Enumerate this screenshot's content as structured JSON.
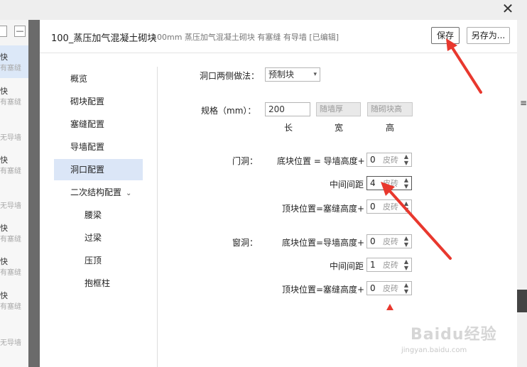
{
  "background_list": {
    "items": [
      {
        "a": "快",
        "b": "有塞缝"
      },
      {
        "a": "快",
        "b": "有塞缝"
      },
      {
        "a": "",
        "b": "无导墙"
      },
      {
        "a": "快",
        "b": "有塞缝"
      },
      {
        "a": "",
        "b": "无导墙"
      },
      {
        "a": "快",
        "b": "有塞缝"
      },
      {
        "a": "快",
        "b": "有塞缝"
      },
      {
        "a": "快",
        "b": "有塞缝"
      },
      {
        "a": "",
        "b": "无导墙"
      }
    ],
    "btn_a": "",
    "btn_b": "—"
  },
  "right_edge_glyph": "≡",
  "close_label": "✕",
  "dialog": {
    "title": "100_蒸压加气混凝土砌块",
    "subtitle": "100mm 蒸压加气混凝土砌块 有塞缝 有导墙 [已编辑]",
    "save_label": "保存",
    "save_as_label": "另存为..."
  },
  "nav": {
    "items": [
      "概览",
      "砌块配置",
      "塞缝配置",
      "导墙配置",
      "洞口配置",
      "二次结构配置"
    ],
    "sub_items": [
      "腰梁",
      "过梁",
      "压顶",
      "抱框柱"
    ],
    "active_index": 4,
    "chevron": "⌄"
  },
  "form": {
    "opening_method_label": "洞口两侧做法：",
    "opening_method_value": "预制块",
    "spec_label": "规格（mm）：",
    "length_value": "200",
    "width_placeholder": "随墙厚",
    "height_placeholder": "随砌块高",
    "length_caption": "长",
    "width_caption": "宽",
    "height_caption": "高",
    "door": {
      "label": "门洞：",
      "bottom_label": "底块位置 = 导墙高度+",
      "bottom_value": "0",
      "middle_label": "中间间距",
      "middle_value": "4",
      "top_label": "顶块位置=塞缝高度+",
      "top_value": "0"
    },
    "window": {
      "label": "窗洞：",
      "bottom_label": "底块位置=导墙高度+",
      "bottom_value": "0",
      "middle_label": "中间间距",
      "middle_value": "1",
      "top_label": "顶块位置=塞缝高度+",
      "top_value": "0"
    },
    "unit": "皮砖"
  },
  "watermark": {
    "main": "Baidu经验",
    "sub": "jingyan.baidu.com"
  },
  "accent_color": "#e8382e"
}
